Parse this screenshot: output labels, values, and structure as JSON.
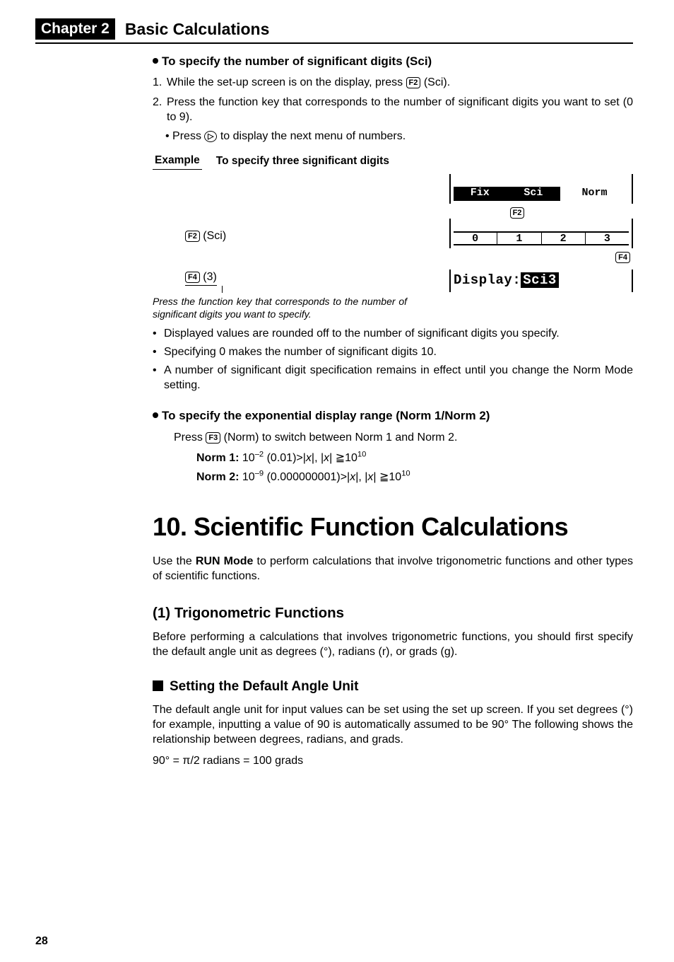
{
  "chapter": {
    "badge": "Chapter 2",
    "title": "Basic Calculations"
  },
  "sci": {
    "head": "To specify the number of significant digits (Sci)",
    "step1_a": "While the set-up screen is on the display, press ",
    "step1_key": "F2",
    "step1_b": " (Sci).",
    "step2": "Press the function key that corresponds to the number of significant digits you want to set (0 to 9).",
    "step3_a": "Press ",
    "step3_key": "▷",
    "step3_b": " to display the next menu of numbers."
  },
  "example": {
    "label": "Example",
    "text": "To specify three significant digits",
    "act1_key": "F2",
    "act1_suffix": " (Sci)",
    "act2_key": "F4",
    "act2_suffix": " (3)",
    "note": "Press the function key that corresponds to the number of significant digits you want to specify."
  },
  "lcd1": {
    "cells": [
      "Fix",
      "Sci",
      "Norm"
    ],
    "below_key": "F2"
  },
  "lcd2": {
    "cells": [
      "0",
      "1",
      "2",
      "3"
    ],
    "below_key": "F4"
  },
  "lcd3": {
    "text_plain": "Display:",
    "text_inv": "Sci3"
  },
  "bullets_after_example": [
    "Displayed values are rounded off to the number of significant digits you specify.",
    "Specifying 0 makes the number of significant digits 10.",
    "A number of significant digit specification remains in effect until you change the Norm Mode setting."
  ],
  "norm": {
    "head": "To specify the exponential display range (Norm 1/Norm 2)",
    "line_a": "Press ",
    "line_key": "F3",
    "line_b": " (Norm) to switch between Norm 1 and Norm 2.",
    "n1_label": "Norm 1:",
    "n1_body_a": " 10",
    "n1_exp1": "–2",
    "n1_body_b": " (0.01)>|",
    "n1_body_c": "|, |",
    "n1_body_d": "| ≧10",
    "n1_exp2": "10",
    "n2_label": "Norm 2:",
    "n2_body_a": " 10",
    "n2_exp1": "–9",
    "n2_body_b": " (0.000000001)>|",
    "n2_body_c": "|, |",
    "n2_body_d": "| ≧10",
    "n2_exp2": "10"
  },
  "section": {
    "title": "10. Scientific Function Calculations",
    "intro_a": "Use the ",
    "intro_bold": "RUN Mode",
    "intro_b": " to perform calculations that involve trigonometric functions and other types of scientific functions."
  },
  "trig": {
    "head": "(1) Trigonometric Functions",
    "body": "Before performing a calculations that involves trigonometric functions, you should first specify the default angle unit as degrees (°), radians (r), or grads (g)."
  },
  "angle": {
    "head": "Setting the Default Angle Unit",
    "body": "The default angle unit for input values can be set using the set up screen. If you set degrees (°) for example, inputting a value of 90 is automatically assumed to be 90° The following shows the relationship between degrees, radians, and grads.",
    "formula": "90° = π/2 radians = 100 grads"
  },
  "page_number": "28"
}
